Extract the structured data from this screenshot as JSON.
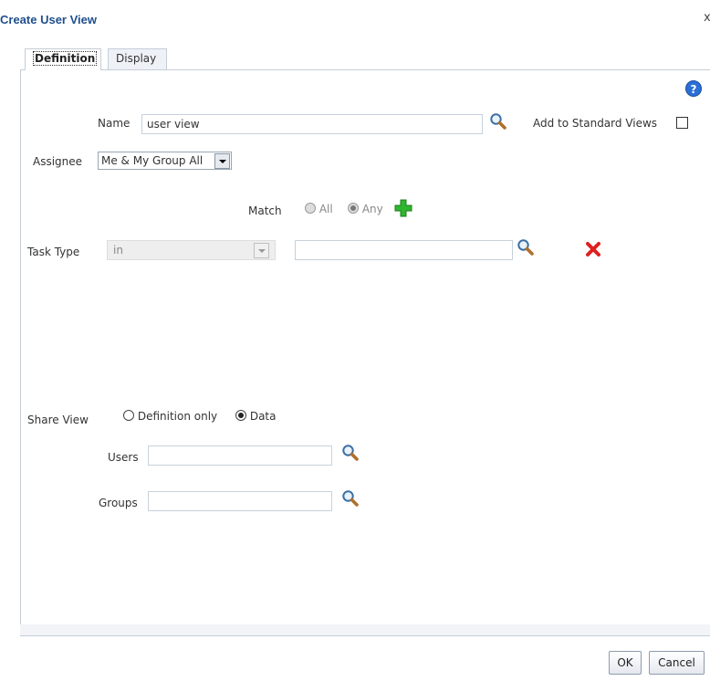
{
  "dialog": {
    "title": "Create User View",
    "close_label": "x"
  },
  "tabs": [
    {
      "label": "Definition",
      "active": true
    },
    {
      "label": "Display",
      "active": false
    }
  ],
  "icons": {
    "help": "?",
    "help_color": "#2b6fd6",
    "search": "search-icon",
    "add": "add-icon",
    "delete": "delete-icon"
  },
  "form": {
    "name_label": "Name",
    "name_value": "user view",
    "add_std_views_label": "Add to Standard Views",
    "add_std_views_checked": false,
    "assignee_label": "Assignee",
    "assignee_value": "Me & My Group All",
    "match_label": "Match",
    "match_all_label": "All",
    "match_any_label": "Any",
    "match_selected": "Any",
    "task_type_label": "Task Type",
    "task_type_operator": "in",
    "task_type_value": "",
    "share_view_label": "Share View",
    "share_def_only_label": "Definition only",
    "share_data_label": "Data",
    "share_selected": "Data",
    "users_label": "Users",
    "users_value": "",
    "groups_label": "Groups",
    "groups_value": ""
  },
  "footer": {
    "ok_label": "OK",
    "cancel_label": "Cancel"
  },
  "colors": {
    "title": "#1f4f8c",
    "add_icon": "#2fb52f",
    "delete_icon": "#e02020",
    "border": "#c5cdd8"
  }
}
